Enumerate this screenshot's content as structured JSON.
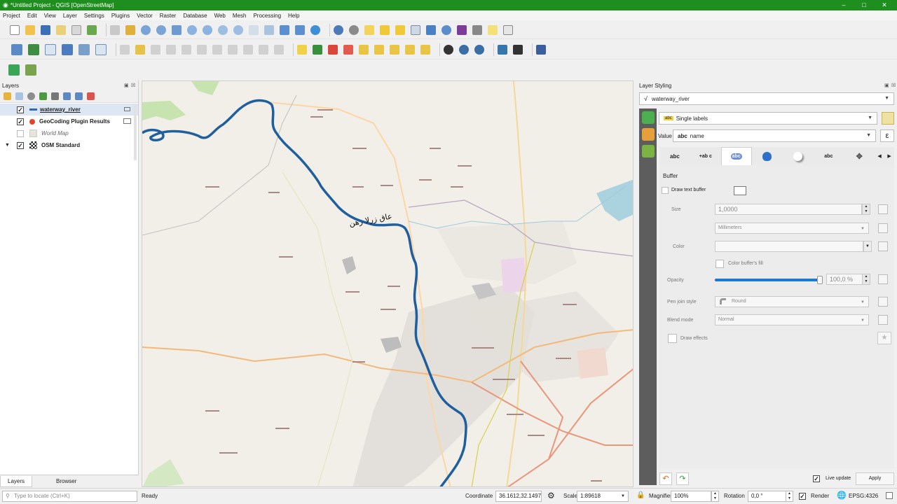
{
  "window": {
    "title": "*Untitled Project - QGIS [OpenStreetMap]",
    "minimize": "–",
    "maximize": "□",
    "close": "✕"
  },
  "menu": [
    "Project",
    "Edit",
    "View",
    "Layer",
    "Settings",
    "Plugins",
    "Vector",
    "Raster",
    "Database",
    "Web",
    "Mesh",
    "Processing",
    "Help"
  ],
  "layers_panel": {
    "title": "Layers",
    "items": [
      {
        "label": "waterway_river",
        "checked": true,
        "icon": "line-symbol-icon",
        "color": "#2a6db5"
      },
      {
        "label": "GeoCoding Plugin Results",
        "checked": true,
        "icon": "point-symbol-icon",
        "color": "#e0452a"
      },
      {
        "label": "World Map",
        "checked": false,
        "icon": "polygon-symbol-icon",
        "color": "#e8e4dc"
      },
      {
        "label": "OSM Standard",
        "checked": true,
        "icon": "raster-icon",
        "color": "#333333"
      }
    ],
    "tabs": [
      "Layers",
      "Browser"
    ]
  },
  "map": {
    "river_label": "عاق زرلا رهن",
    "river_color": "#1f5f9e"
  },
  "styling": {
    "title": "Layer Styling",
    "layer": "waterway_river",
    "renderer": "Single labels",
    "value_label": "Value",
    "value_field": "name",
    "tabs": [
      "abc",
      "+ab c",
      "abc",
      "",
      "",
      "abc",
      ""
    ],
    "section": "Buffer",
    "draw_text_buffer": "Draw text buffer",
    "size_label": "Size",
    "size_value": "1,0000",
    "unit": "Millimeters",
    "color_label": "Color",
    "color_fill": "Color buffer's fill",
    "opacity_label": "Opacity",
    "opacity_value": "100,0 %",
    "opacity_fraction": 1.0,
    "pen_join_label": "Pen join style",
    "pen_join_value": "Round",
    "blend_label": "Blend mode",
    "blend_value": "Normal",
    "draw_effects": "Draw effects",
    "live_update": "Live update",
    "apply": "Apply"
  },
  "status": {
    "search_placeholder": "Type to locate (Ctrl+K)",
    "ready": "Ready",
    "coordinate_label": "Coordinate",
    "coordinate_value": "36.1612,32.1497",
    "scale_label": "Scale",
    "scale_value": "1:89618",
    "magnifier_label": "Magnifier",
    "magnifier_value": "100%",
    "rotation_label": "Rotation",
    "rotation_value": "0,0 °",
    "render_label": "Render",
    "crs": "EPSG:4326"
  }
}
